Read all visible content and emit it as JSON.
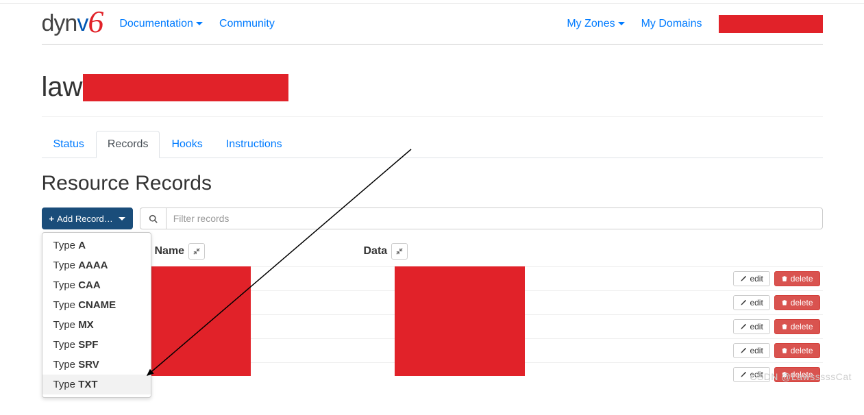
{
  "nav": {
    "documentation": "Documentation",
    "community": "Community",
    "my_zones": "My Zones",
    "my_domains": "My Domains"
  },
  "logo": {
    "part1": "dyn",
    "part2": "v",
    "part3": "6"
  },
  "page": {
    "title_prefix": "law"
  },
  "tabs": {
    "status": "Status",
    "records": "Records",
    "hooks": "Hooks",
    "instructions": "Instructions"
  },
  "section": {
    "title": "Resource Records"
  },
  "toolbar": {
    "add_label": "Add Record…",
    "filter_placeholder": "Filter records"
  },
  "columns": {
    "name": "Name",
    "data": "Data"
  },
  "dropdown": {
    "prefix": "Type ",
    "items": [
      "A",
      "AAAA",
      "CAA",
      "CNAME",
      "MX",
      "SPF",
      "SRV",
      "TXT"
    ]
  },
  "actions": {
    "edit": "edit",
    "delete": "delete"
  },
  "row_count": 5,
  "watermark": "CSDN @LawsssssCat"
}
